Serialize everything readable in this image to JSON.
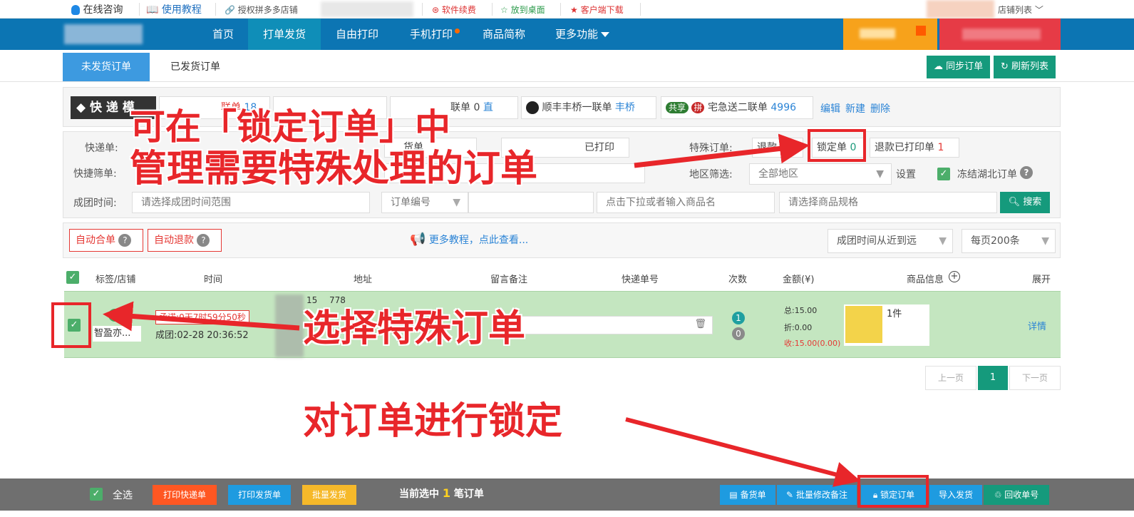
{
  "topbar": {
    "online_consult": "在线咨询",
    "tutorial": "使用教程",
    "authorize": "授权拼多多店铺",
    "renew": "软件续费",
    "desktop": "放到桌面",
    "client_download": "客户端下载",
    "store_list": "店铺列表"
  },
  "nav": {
    "items": [
      "首页",
      "打单发货",
      "自由打印",
      "手机打印",
      "商品简称",
      "更多功能"
    ]
  },
  "tabs": {
    "unshipped": "未发货订单",
    "shipped": "已发货订单"
  },
  "actions": {
    "sync": "同步订单",
    "refresh": "刷新列表"
  },
  "express": {
    "label": "◆ 快 递 模",
    "t1_name": "联单",
    "t1_count": "18",
    "t3_name": "联单",
    "t3_count": "0",
    "t3_link": "直",
    "sf_name": "顺丰丰桥一联单",
    "sf_link": "丰桥",
    "shared_tag": "共享",
    "pin_tag": "拼",
    "zjs_name": "宅急送二联单",
    "zjs_count": "4996",
    "edit": "编辑",
    "create": "新建",
    "delete": "删除"
  },
  "filters": {
    "express_label": "快递单:",
    "quick_label": "快捷筛单:",
    "time_label": "成团时间:",
    "time_placeholder": "请选择成团时间范围",
    "goods_label": "货单",
    "printed_label": "已打印",
    "special_label": "特殊订单:",
    "refund_label": "退款",
    "locked_label": "锁定单",
    "locked_count": "0",
    "refund_printed_label": "退款已打印单",
    "refund_printed_count": "1",
    "region_label": "地区筛选:",
    "region_value": "全部地区",
    "setting": "设置",
    "freeze_hubei": "冻结湖北订单",
    "order_no_select": "订单编号",
    "goods_placeholder": "点击下拉或者输入商品名",
    "spec_placeholder": "请选择商品规格",
    "search": "搜索"
  },
  "toolbar": {
    "auto_merge": "自动合单",
    "auto_refund": "自动退款",
    "more_tutorial": "更多教程，点此查看...",
    "sort": "成团时间从近到远",
    "page_size": "每页200条"
  },
  "table": {
    "headers": [
      "标签/店铺",
      "时间",
      "地址",
      "留言备注",
      "快递单号",
      "次数",
      "金额(¥)",
      "商品信息",
      "展开"
    ]
  },
  "order": {
    "store": "智盈亦...",
    "countdown": "承诺:0天7时59分50秒",
    "group_time": "成团:02-28 20:36:52",
    "phone_partial": "15",
    "phone_partial2": "778",
    "count1": "1",
    "count2": "0",
    "total": "总:15.00",
    "discount": "折:0.00",
    "received": "收:15.00(0.00)",
    "qty": "1件",
    "detail": "详情"
  },
  "pagination": {
    "prev": "上一页",
    "current": "1",
    "next": "下一页"
  },
  "bottom": {
    "select_all": "全选",
    "print_express": "打印快递单",
    "print_invoice": "打印发货单",
    "batch_ship": "批量发货",
    "selected_prefix": "当前选中",
    "selected_count": "1",
    "selected_suffix": "笔订单",
    "stock_list": "备货单",
    "batch_remark": "批量修改备注",
    "lock_order": "锁定订单",
    "import_ship": "导入发货",
    "recycle": "回收单号"
  },
  "annotations": {
    "line1": "可在「锁定订单」中",
    "line2": "管理需要特殊处理的订单",
    "select": "选择特殊订单",
    "lock": "对订单进行锁定"
  },
  "colors": {
    "nav_bg": "#0c75b3",
    "accent_green": "#159a7c",
    "annotation_red": "#e8262a",
    "row_green": "#c4e6c0"
  }
}
